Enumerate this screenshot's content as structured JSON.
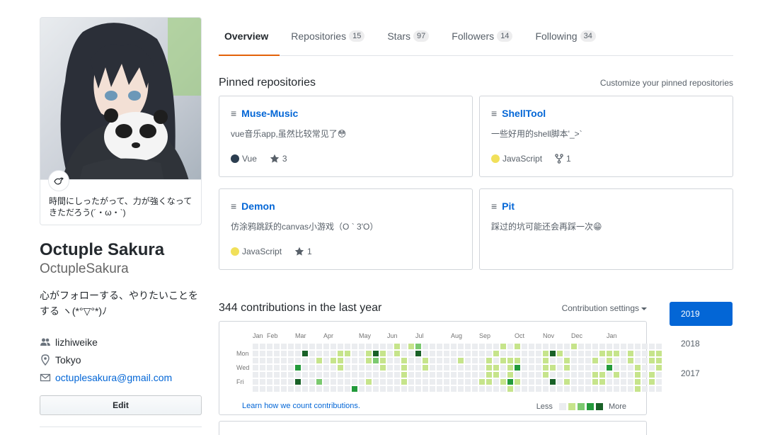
{
  "profile": {
    "status_text": "時間にしったがって、力が強くなってきただろう(´・ω・`)",
    "status_emoji": "dove-emoji",
    "full_name": "Octuple Sakura",
    "login": "OctupleSakura",
    "bio": "心がフォローする、やりたいことをする ヽ(*°▽°*)ﾉ",
    "organization": "lizhiweike",
    "location": "Tokyo",
    "email": "octuplesakura@gmail.com",
    "edit_label": "Edit"
  },
  "tabs": [
    {
      "label": "Overview",
      "count": "",
      "selected": true
    },
    {
      "label": "Repositories",
      "count": "15"
    },
    {
      "label": "Stars",
      "count": "97"
    },
    {
      "label": "Followers",
      "count": "14"
    },
    {
      "label": "Following",
      "count": "34"
    }
  ],
  "pinned": {
    "title": "Pinned repositories",
    "customize_label": "Customize your pinned repositories",
    "repos": [
      {
        "name": "Muse-Music",
        "description": "vue音乐app,虽然比较常见了😳",
        "language": "Vue",
        "language_color": "#2c3e50",
        "meta_icon": "star-icon",
        "meta_value": "3"
      },
      {
        "name": "ShellTool",
        "description": "一些好用的shell脚本'_>`",
        "language": "JavaScript",
        "language_color": "#f1e05a",
        "meta_icon": "fork-icon",
        "meta_value": "1"
      },
      {
        "name": "Demon",
        "description": "仿涂鸦跳跃的canvas小游戏（O ` 3'O）",
        "language": "JavaScript",
        "language_color": "#f1e05a",
        "meta_icon": "star-icon",
        "meta_value": "1"
      },
      {
        "name": "Pit",
        "description": "踩过的坑可能还会再踩一次😁",
        "language": "",
        "language_color": "",
        "meta_icon": "",
        "meta_value": ""
      }
    ]
  },
  "contributions": {
    "title": "344 contributions in the last year",
    "settings_label": "Contribution settings",
    "months": [
      "Jan",
      "Feb",
      "Mar",
      "Apr",
      "May",
      "Jun",
      "Jul",
      "Aug",
      "Sep",
      "Oct",
      "Nov",
      "Dec",
      "Jan"
    ],
    "days": [
      "Mon",
      "Wed",
      "Fri"
    ],
    "learn_link": "Learn how we count contributions.",
    "legend_less": "Less",
    "legend_more": "More",
    "colors": [
      "#ebedf0",
      "#c6e48b",
      "#7bc96f",
      "#239a3b",
      "#196127"
    ],
    "weeks": [
      [
        0,
        0,
        0,
        0,
        0,
        0,
        0
      ],
      [
        0,
        0,
        0,
        0,
        0,
        0,
        0
      ],
      [
        0,
        0,
        0,
        0,
        0,
        0,
        0
      ],
      [
        0,
        0,
        0,
        0,
        0,
        0,
        0
      ],
      [
        0,
        0,
        0,
        0,
        0,
        0,
        0
      ],
      [
        0,
        0,
        0,
        0,
        0,
        0,
        0
      ],
      [
        0,
        0,
        0,
        3,
        0,
        4,
        0
      ],
      [
        0,
        4,
        0,
        0,
        0,
        0,
        0
      ],
      [
        0,
        0,
        0,
        0,
        0,
        0,
        0
      ],
      [
        0,
        0,
        1,
        0,
        0,
        2,
        0
      ],
      [
        0,
        0,
        0,
        0,
        0,
        0,
        0
      ],
      [
        0,
        0,
        1,
        0,
        0,
        0,
        0
      ],
      [
        0,
        1,
        1,
        1,
        0,
        0,
        0
      ],
      [
        0,
        1,
        0,
        0,
        0,
        0,
        0
      ],
      [
        0,
        0,
        0,
        0,
        0,
        0,
        3
      ],
      [
        0,
        0,
        0,
        0,
        0,
        0,
        0
      ],
      [
        0,
        1,
        1,
        0,
        0,
        1,
        0
      ],
      [
        0,
        4,
        2,
        0,
        0,
        0,
        0
      ],
      [
        0,
        1,
        1,
        1,
        0,
        0,
        0
      ],
      [
        0,
        0,
        0,
        0,
        0,
        0,
        0
      ],
      [
        1,
        1,
        0,
        0,
        0,
        0,
        0
      ],
      [
        0,
        0,
        1,
        1,
        1,
        1,
        0
      ],
      [
        1,
        0,
        0,
        0,
        0,
        0,
        0
      ],
      [
        2,
        4,
        0,
        0,
        0,
        0,
        0
      ],
      [
        0,
        0,
        1,
        1,
        0,
        0,
        0
      ],
      [
        0,
        0,
        0,
        0,
        0,
        0,
        0
      ],
      [
        0,
        0,
        0,
        0,
        0,
        0,
        0
      ],
      [
        0,
        0,
        0,
        0,
        0,
        0,
        0
      ],
      [
        0,
        0,
        0,
        0,
        0,
        0,
        0
      ],
      [
        0,
        0,
        1,
        0,
        0,
        0,
        0
      ],
      [
        0,
        0,
        0,
        0,
        0,
        0,
        0
      ],
      [
        0,
        0,
        0,
        0,
        0,
        0,
        0
      ],
      [
        0,
        0,
        0,
        0,
        0,
        1,
        0
      ],
      [
        0,
        0,
        1,
        1,
        1,
        1,
        0
      ],
      [
        0,
        1,
        0,
        1,
        1,
        0,
        0
      ],
      [
        1,
        0,
        1,
        0,
        0,
        1,
        0
      ],
      [
        0,
        0,
        1,
        1,
        1,
        3,
        1
      ],
      [
        1,
        0,
        1,
        3,
        0,
        1,
        0
      ],
      [
        0,
        0,
        0,
        0,
        0,
        0,
        0
      ],
      [
        0,
        0,
        0,
        0,
        0,
        0,
        0
      ],
      [
        0,
        0,
        0,
        0,
        0,
        0,
        0
      ],
      [
        0,
        1,
        1,
        1,
        1,
        0,
        0
      ],
      [
        0,
        4,
        0,
        1,
        0,
        4,
        0
      ],
      [
        0,
        1,
        0,
        0,
        0,
        0,
        0
      ],
      [
        0,
        0,
        1,
        1,
        0,
        1,
        0
      ],
      [
        1,
        0,
        0,
        0,
        0,
        0,
        0
      ],
      [
        0,
        0,
        0,
        0,
        0,
        0,
        0
      ],
      [
        0,
        0,
        0,
        0,
        0,
        0,
        0
      ],
      [
        0,
        0,
        1,
        0,
        1,
        1,
        0
      ],
      [
        0,
        1,
        0,
        0,
        1,
        1,
        0
      ],
      [
        0,
        1,
        1,
        3,
        0,
        0,
        0
      ],
      [
        0,
        1,
        0,
        0,
        1,
        0,
        0
      ],
      [
        0,
        0,
        0,
        0,
        0,
        0,
        0
      ],
      [
        0,
        1,
        1,
        0,
        0,
        0,
        0
      ],
      [
        0,
        0,
        0,
        1,
        1,
        1,
        1
      ],
      [
        0,
        0,
        0,
        0,
        0,
        0,
        0
      ],
      [
        0,
        1,
        1,
        0,
        1,
        1,
        0
      ],
      [
        0,
        1,
        1,
        1,
        0,
        0,
        0
      ]
    ]
  },
  "years": [
    {
      "label": "2019",
      "selected": true
    },
    {
      "label": "2018"
    },
    {
      "label": "2017"
    }
  ]
}
